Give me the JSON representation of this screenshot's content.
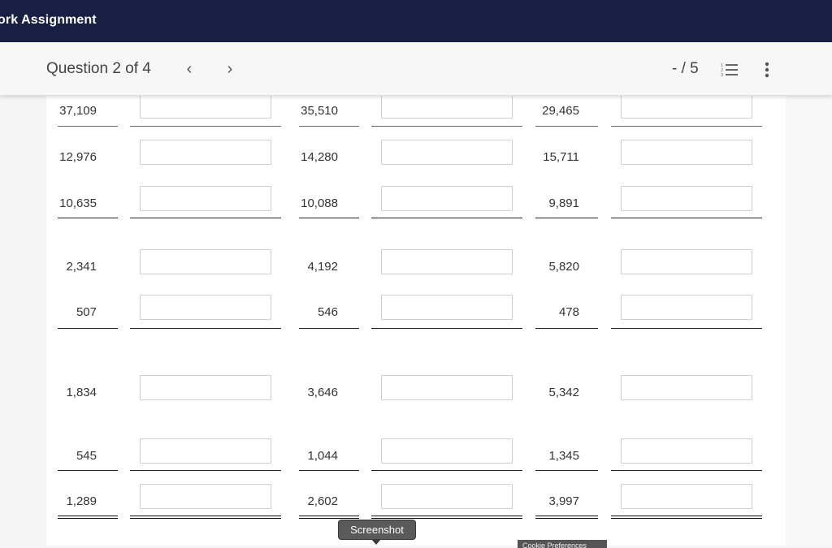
{
  "header": {
    "title": "ork Assignment"
  },
  "question_bar": {
    "label": "Question 2 of 4",
    "prev_icon": "chevron-left-icon",
    "next_icon": "chevron-right-icon",
    "prev_glyph": "‹",
    "next_glyph": "›",
    "score": "- / 5",
    "list_icon": "numbered-list-icon",
    "more_icon": "more-vertical-icon"
  },
  "worksheet": {
    "rows": [
      {
        "values": [
          "37,109",
          "35,510",
          "29,465"
        ],
        "answers": [
          "",
          "",
          ""
        ]
      },
      {
        "values": [
          "12,976",
          "14,280",
          "15,711"
        ],
        "answers": [
          "",
          "",
          ""
        ]
      },
      {
        "values": [
          "10,635",
          "10,088",
          "9,891"
        ],
        "answers": [
          "",
          "",
          ""
        ]
      },
      {
        "values": [
          "2,341",
          "4,192",
          "5,820"
        ],
        "answers": [
          "",
          "",
          ""
        ]
      },
      {
        "values": [
          "507",
          "546",
          "478"
        ],
        "answers": [
          "",
          "",
          ""
        ]
      },
      {
        "values": [
          "1,834",
          "3,646",
          "5,342"
        ],
        "answers": [
          "",
          "",
          ""
        ]
      },
      {
        "values": [
          "545",
          "1,044",
          "1,345"
        ],
        "answers": [
          "",
          "",
          ""
        ]
      },
      {
        "values": [
          "1,289",
          "2,602",
          "3,997"
        ],
        "answers": [
          "",
          "",
          ""
        ]
      }
    ]
  },
  "tooltip": {
    "text": "Screenshot"
  },
  "cookie": {
    "text": "Cookie Preferences"
  }
}
